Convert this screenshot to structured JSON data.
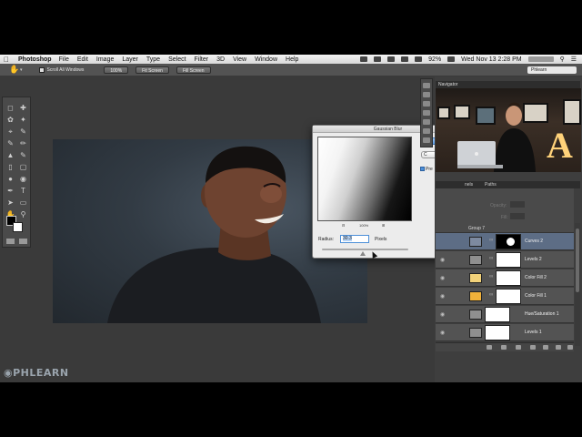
{
  "menubar": {
    "app_name": "Photoshop",
    "items": [
      "File",
      "Edit",
      "Image",
      "Layer",
      "Type",
      "Select",
      "Filter",
      "3D",
      "View",
      "Window",
      "Help"
    ],
    "battery": "92%",
    "clock": "Wed Nov 13  2:28 PM"
  },
  "options_bar": {
    "scroll_all_windows": "Scroll All Windows",
    "btn_100": "100%",
    "btn_fit_screen": "Fit Screen",
    "btn_fill_screen": "Fill Screen",
    "workspace": "Phlearn"
  },
  "dialog": {
    "title": "Gaussian Blur",
    "zoom_level": "100%",
    "radius_label": "Radius:",
    "radius_value": "30.3",
    "units": "Pixels",
    "cancel_label": "C",
    "preview_label": "Pre"
  },
  "navigator": {
    "title": "Navigator"
  },
  "panel_tabs": {
    "tab_b": "nels",
    "tab_c": "Paths",
    "opacity_label": "Opacity:",
    "fill_label": "Fill:"
  },
  "layers": [
    {
      "name": "Group 7",
      "type": "group"
    },
    {
      "name": "Curves 2",
      "selected": true
    },
    {
      "name": "Levels 2"
    },
    {
      "name": "Color Fill 2",
      "swatch": "#f2d27a"
    },
    {
      "name": "Color Fill 1",
      "swatch": "#f0b13a"
    },
    {
      "name": "Hue/Saturation 1"
    },
    {
      "name": "Levels 1"
    }
  ],
  "watermark": "PHLEARN"
}
